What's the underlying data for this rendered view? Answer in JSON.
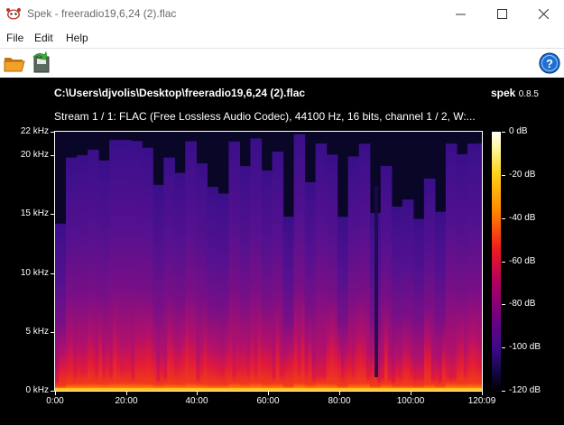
{
  "window": {
    "title": "Spek - freeradio19,6,24 (2).flac"
  },
  "menu": [
    "File",
    "Edit",
    "Help"
  ],
  "toolbar": {
    "open_icon": "folder-open-icon",
    "save_icon": "save-icon",
    "help_icon": "help-icon"
  },
  "spectrum": {
    "file_path": "C:\\Users\\djvolis\\Desktop\\freeradio19,6,24 (2).flac",
    "brand": "spek",
    "version": "0.8.5",
    "stream_info": "Stream 1 / 1: FLAC (Free Lossless Audio Codec), 44100 Hz, 16 bits, channel 1 / 2, W:..."
  },
  "chart_data": {
    "type": "heatmap",
    "xlabel": "",
    "ylabel": "",
    "x_tick_labels": [
      "0:00",
      "20:00",
      "40:00",
      "60:00",
      "80:00",
      "100:00",
      "120:09"
    ],
    "x_tick_values_min": [
      0,
      20,
      40,
      60,
      80,
      100,
      120.15
    ],
    "y_tick_labels": [
      "0 kHz",
      "5 kHz",
      "10 kHz",
      "15 kHz",
      "20 kHz",
      "22 kHz"
    ],
    "y_tick_values_khz": [
      0,
      5,
      10,
      15,
      20,
      22
    ],
    "ylim_khz": [
      0,
      22
    ],
    "xlim_min": [
      0,
      120.15
    ],
    "colorbar": {
      "labels": [
        "0 dB",
        "-20 dB",
        "-40 dB",
        "-60 dB",
        "-80 dB",
        "-100 dB",
        "-120 dB"
      ],
      "values_db": [
        0,
        -20,
        -40,
        -60,
        -80,
        -100,
        -120
      ]
    },
    "colors": {
      "background": "#000000",
      "high": "#ffd21a",
      "mid": "#e0103a",
      "low": "#5a1590",
      "floor": "#0a0628"
    }
  }
}
